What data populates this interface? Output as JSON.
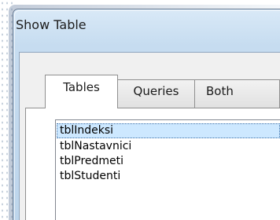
{
  "dialog": {
    "title": "Show Table"
  },
  "tabs": [
    {
      "label": "Tables",
      "active": true
    },
    {
      "label": "Queries",
      "active": false
    },
    {
      "label": "Both",
      "active": false
    }
  ],
  "tables_list": {
    "items": [
      "tblIndeksi",
      "tblNastavnici",
      "tblPredmeti",
      "tblStudenti"
    ],
    "selected_index": 0
  },
  "colors": {
    "title_bar": "#c6dcf0",
    "selection": "#cde8ff",
    "selection_border": "#3b6fa8"
  }
}
